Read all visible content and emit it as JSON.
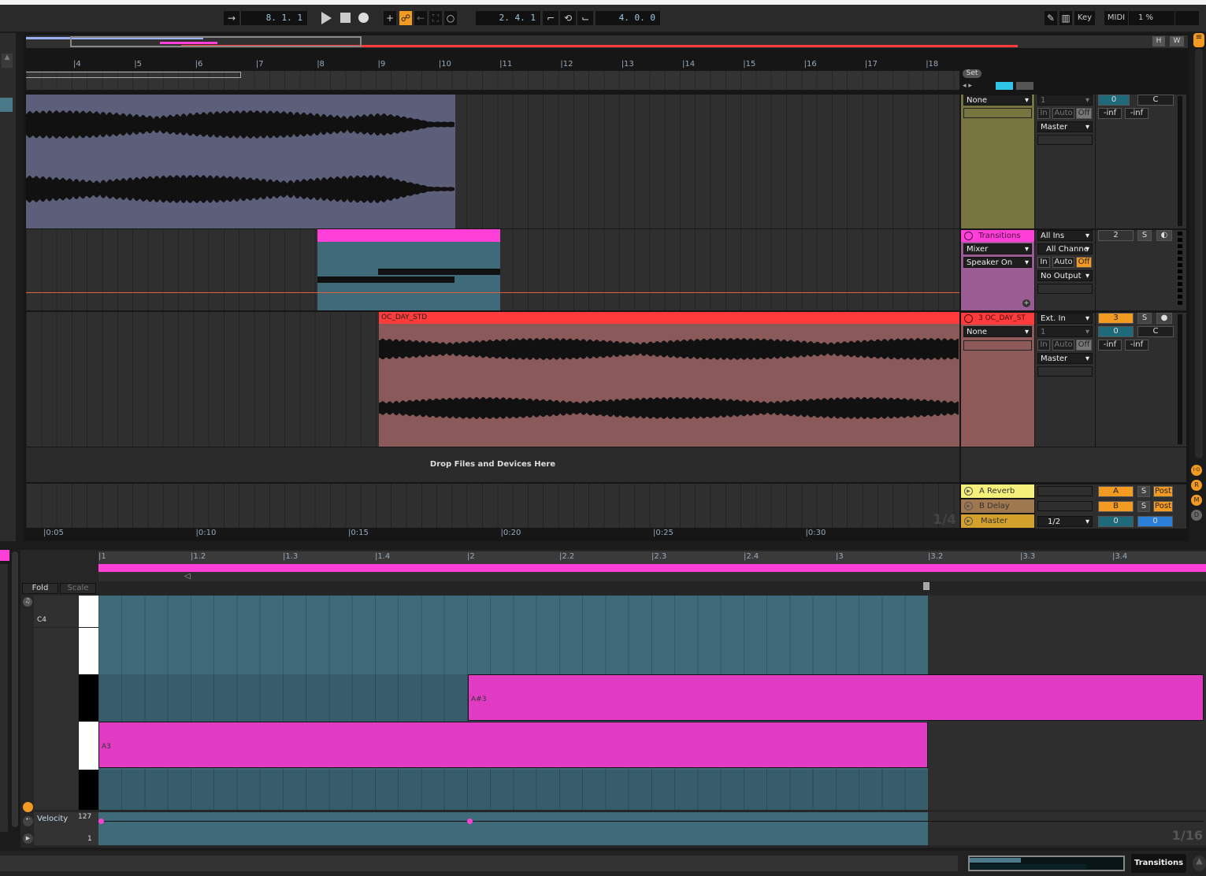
{
  "transport": {
    "follow_icon": "follow-arrow-icon",
    "position": "8.  1.  1",
    "play_icon": "play-icon",
    "stop_icon": "stop-icon",
    "record_icon": "record-icon",
    "loop_start": "2.  4.  1",
    "loop_length": "4.  0.  0"
  },
  "toolbar_right": {
    "draw_icon": "pencil-icon",
    "keys_icon": "piano-icon",
    "key_label": "Key",
    "midi_label": "MIDI",
    "cpu": "1 %",
    "h_label": "H",
    "w_label": "W"
  },
  "arrangement": {
    "bars": [
      "4",
      "5",
      "6",
      "7",
      "8",
      "9",
      "10",
      "11",
      "12",
      "13",
      "14",
      "15",
      "16",
      "17",
      "18"
    ],
    "times": [
      "0:05",
      "0:10",
      "0:15",
      "0:20",
      "0:25",
      "0:30"
    ],
    "grid": "1/4",
    "drop_text": "Drop Files and Devices Here",
    "set_label": "Set",
    "clips": {
      "midi_color": "#ff3fd7",
      "audio3_name": "OC_DAY_STD",
      "audio3_color": "#ff3b3b"
    }
  },
  "tracks": [
    {
      "name": "",
      "input": "None",
      "channel": "1",
      "monitor": [
        "In",
        "Auto",
        "Off"
      ],
      "output": "Master",
      "number": "0",
      "pan": "C",
      "vol_l": "-inf",
      "vol_r": "-inf",
      "color": "#76743f"
    },
    {
      "name": "Transitions",
      "devices": [
        "Mixer",
        "Speaker On"
      ],
      "input": "All Ins",
      "channel": "All Channe",
      "monitor": [
        "In",
        "Auto",
        "Off"
      ],
      "output": "No Output",
      "number": "2",
      "solo": "S",
      "color": "#ff3fd7"
    },
    {
      "name": "3 OC_DAY_ST",
      "input": "None",
      "input_type": "Ext. In",
      "channel": "1",
      "monitor": [
        "In",
        "Auto",
        "Off"
      ],
      "output": "Master",
      "number": "3",
      "solo": "S",
      "vol": "0",
      "pan": "C",
      "vol_l": "-inf",
      "vol_r": "-inf",
      "color": "#ff3b3b"
    }
  ],
  "returns": [
    {
      "name": "A Reverb",
      "letter": "A",
      "solo": "S",
      "mode": "Post",
      "color": "#f5f07a"
    },
    {
      "name": "B Delay",
      "letter": "B",
      "solo": "S",
      "mode": "Post",
      "color": "#a07850"
    },
    {
      "name": "Master",
      "output": "1/2",
      "vol": "0",
      "pan": "0",
      "color": "#d4a22c"
    }
  ],
  "side_buttons": [
    "I·O",
    "R",
    "M",
    "D"
  ],
  "clip_editor": {
    "ruler": [
      "1",
      "1.2",
      "1.3",
      "1.4",
      "2",
      "2.2",
      "2.3",
      "2.4",
      "3",
      "3.2",
      "3.3",
      "3.4"
    ],
    "fold": "Fold",
    "scale": "Scale",
    "key_label": "C4",
    "notes": [
      {
        "name": "A#3"
      },
      {
        "name": "A3"
      }
    ],
    "velocity_label": "Velocity",
    "vel_max": "127",
    "vel_min": "1",
    "grid": "1/16"
  },
  "status": {
    "track_name": "Transitions"
  }
}
